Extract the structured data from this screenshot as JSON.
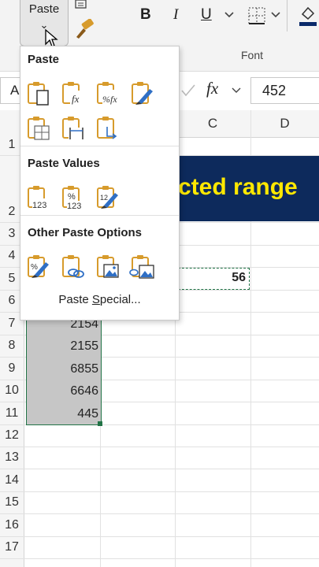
{
  "ribbon": {
    "paste_label": "Paste",
    "paste_chevron": "⌄",
    "bold": "B",
    "italic": "I",
    "underline": "U",
    "font_group_label": "Font"
  },
  "formula_bar": {
    "name_box_partial": "A",
    "fx": "fx",
    "value": "452"
  },
  "columns": [
    "C",
    "D"
  ],
  "rows": [
    "1",
    "2",
    "3",
    "4",
    "5",
    "6",
    "7",
    "8",
    "9",
    "10",
    "11",
    "12",
    "13",
    "14",
    "15",
    "16",
    "17"
  ],
  "banner_text": "cted range",
  "cells": {
    "c5": "56",
    "b7": "2154",
    "b8": "2155",
    "b9": "6855",
    "b10": "6646",
    "b11": "445"
  },
  "paste_menu": {
    "section_paste": "Paste",
    "section_values": "Paste Values",
    "section_other": "Other Paste Options",
    "special_pre": "Paste ",
    "special_ul": "S",
    "special_post": "pecial...",
    "paste_icons": [
      "paste",
      "paste-formulas",
      "paste-formulas-number-formatting",
      "keep-source-formatting",
      "no-borders",
      "keep-column-widths",
      "transpose"
    ],
    "values_icons": [
      "values",
      "values-number-formatting",
      "values-source-formatting"
    ],
    "other_icons": [
      "formatting",
      "paste-link",
      "picture",
      "linked-picture"
    ],
    "icon_subtext": {
      "fx": "fx",
      "pct_fx": "%fx",
      "v123": "123",
      "pct": "%"
    }
  },
  "colors": {
    "banner_bg": "#0d2a5c",
    "banner_text": "#ffe800",
    "selection": "#c6c6c6",
    "accent": "#217346",
    "clipboard": "#d79b2c"
  }
}
